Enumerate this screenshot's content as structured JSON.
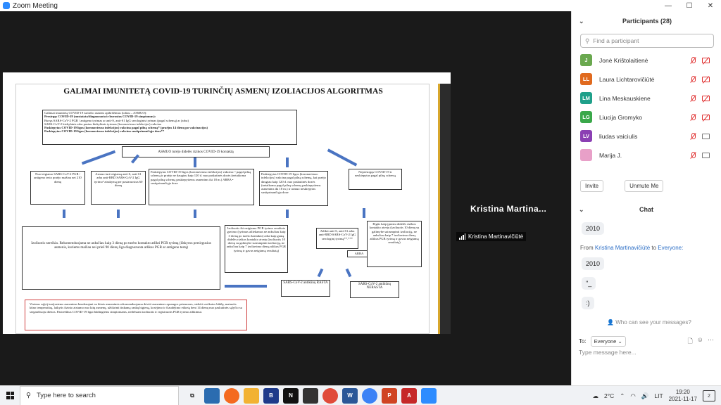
{
  "window": {
    "title": "Zoom Meeting",
    "minimize": "—",
    "maximize": "☐",
    "close": "✕"
  },
  "slide": {
    "title": "GALIMAI IMUNITETĄ COVID-19 TURINČIŲ ASMENŲ IZOLIACIJOS ALGORITMAS",
    "intro": [
      "Galimai imunitetą COVID-19 turinčio asmens apibrėžimas (toliau – ASMUO):",
      "Persirgęs COVID-19 (nustatyta/diagnozuota ir buvusius COVID-19 simptomus):",
      "Buvęs SARS-CoV-2 PGR / antigeno tyrimas ar anti-S, anti-S1 IgG serologinis tyrimas (pagal schemą) ar (arba)",
      "SARS-CoV-2 kiekybinis arba pusiau kiekybinis tyrimas (koronaviruso infekcijos) vakcina",
      "Paskiepytas COVID-19 ligos (koronaviruso infekcijos) vakcina pagal pilną schemą* (praėjus 14 dienų po vakcinacijos)",
      "Paskiepytas COVID-19 ligos (koronaviruso infekcijos) vakcina sustiprinančiąja doze**"
    ],
    "contact": "ASMUO turėjo didelės rizikos COVID-19 kontaktą",
    "col1": "Nuo teigiamo SARS-CoV-2 PGR / antigeno testo praėjo mažiau nei 210 dienų",
    "col2": "Asmuo turi teigiamą anti-S, anti-S1 arba anti-RBD SARS-CoV-2 IgG tyrimo² atsakymą per pastaruosius 60 dienų",
    "col3": "Paskiepytas COVID-19 ligos (koronaviruso infekcijos) vakcina: • pagal pilną schemą ir praėjo ne daugiau kaip 120 d. nuo paskutinės dozės (netaikoma pagal pilną schemą paskiepytiems asmenims iki 18 m.) ARBA • sustiprinančiąja doze",
    "col4": "Paskiepytas COVID-19 ligos (koronaviruso infekcijos) vakcina pagal pilną schemą, kai praėjo daugiau kaip 120 d. nuo paskutinės dozės (netaikoma pagal pilną schemą paskiepytiems asmenims iki 18 m.) ir asmuo neskiepytas sustiprinančiąja doze",
    "col5": "Nepersirgęs COVID-19 ir neskiepytas pagal pilną schemą",
    "result_left": "Izoliuotis nereikia. Rekomenduojama ne anksčiau kaip 3 dieną po turėto kontakto atlikti PGR tyrimą (išskyrus persirgusius asmenis, kuriems mažiau nei prieš 90 dienų liga diagnozuota atlikus PGR ar antigeno testą)",
    "isolate_until": "Izoliuotis iki neigiamo PGR tyrimo rezultato gavimo (tyrimas atliekamas ne anksčiau kaip 3 dieną po turėto kontakto) arba kaip gautą didelės rizikos kontakto atveju (izoliuotis 10 dienų su galimybe sutrumpinti izoliaciją, ne anksčiau kaip 7 izoliavimo dieną atlikus PGR tyrimą ir gavus neigiamą rezultatą)",
    "antibody_test": "Atlikti anti-S, anti-S1 arba anti-RBD SARS-CoV-2 IgG serologinį tyrimą**.***",
    "arba": "ARBA",
    "isolate_10": "Elgtis kaip įprastu didelės rizikos kontakto atveju (izoliuotis 10 dienų su galimybe sutrumpinti izoliaciją, ne anksčiau kaip 7 izoliavimo dieną atlikus PGR tyrimą ir gavus neigiamą rezultatą)",
    "found": "SARS-CoV-2 antikūnų RASTA",
    "not_found": "SARS-CoV-2 antikūnų NERASTA",
    "footer": "Visiems sąlytį turėjusiems asmenims bendraujant su kitais asmenimis rekomenduojama dėvėti asmenines apsaugos priemones, stebėti sveikatos būklę, matuotis kūno temperatūrą, laikytis fizinio atstumo nuo kitų asmenų, užtikrinti tinkamą rankų higieną, kosėjimo ir čiaudėjimo etiketą bent 14 dienų nuo paskutinės sąlyčio su sergančiuoju dienos. Pasireiškus COVID-19 ligai būdingiems simptomams, nedelsiant izoliuotis ir registruotis PGR tyrimo atlikimui."
  },
  "speaker": {
    "name": "Kristina  Martina...",
    "tag": "Kristina Martinavičiūtė"
  },
  "participants": {
    "header": "Participants (28)",
    "search_placeholder": "Find a participant",
    "list": [
      {
        "initials": "J",
        "name": "Jonė Krištolaitienė",
        "color": "#6aa84f"
      },
      {
        "initials": "LL",
        "name": "Laura Lichtarovičiūtė",
        "color": "#e06a1f"
      },
      {
        "initials": "LM",
        "name": "Lina Meskauskiene",
        "color": "#1fa08a"
      },
      {
        "initials": "LG",
        "name": "Liucija Gromyko",
        "color": "#3aa84a"
      },
      {
        "initials": "LV",
        "name": "liudas vaiciulis",
        "color": "#8b3fb3"
      },
      {
        "initials": "",
        "name": "Marija J.",
        "color": "#e8a0c8"
      }
    ],
    "invite": "Invite",
    "unmute": "Unmute Me"
  },
  "chat": {
    "header": "Chat",
    "messages": [
      "2010",
      "2010",
      "\"_",
      ":)"
    ],
    "from_label": "From",
    "from_name": "Kristina Martinavičiūtė",
    "to_word": "to",
    "to_name": "Everyone:",
    "who_can_see": "Who can see your messages?",
    "to_label": "To:",
    "to_value": "Everyone",
    "placeholder": "Type message here..."
  },
  "taskbar": {
    "search": "Type here to search",
    "weather": "2°C",
    "lang": "LIT",
    "time": "19:20",
    "date": "2021-11-17",
    "notif_count": "2"
  }
}
